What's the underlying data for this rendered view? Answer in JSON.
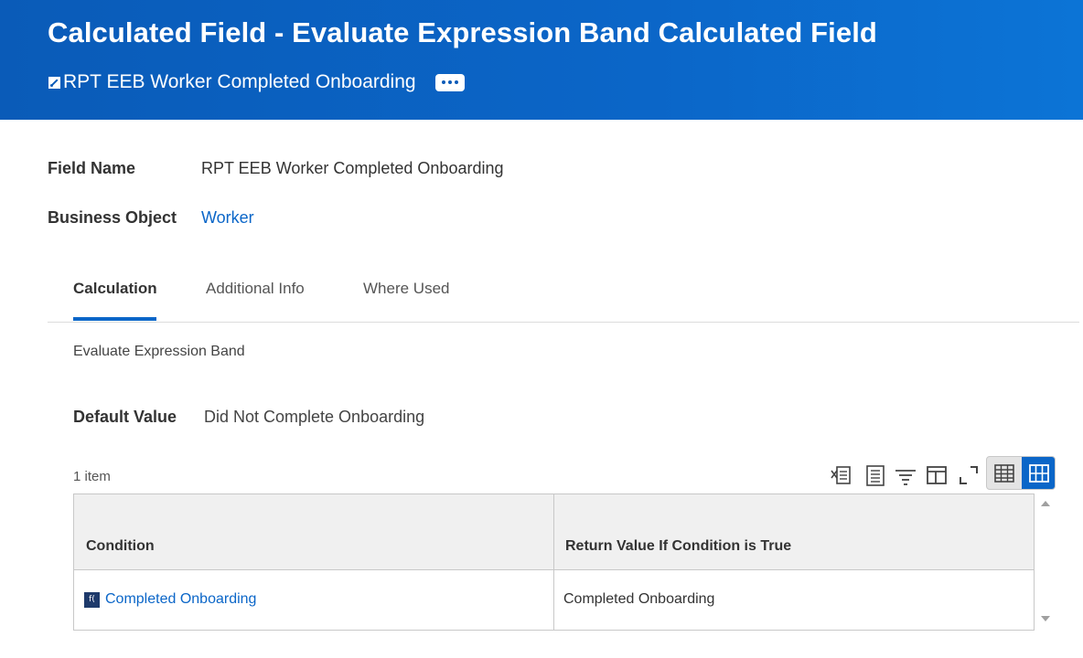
{
  "header": {
    "title": "Calculated Field - Evaluate Expression Band Calculated Field",
    "subtitle": "RPT EEB Worker Completed Onboarding",
    "subtitle_icon": "related-object-icon",
    "more_icon": "more-options-icon",
    "background": "#0b66c8"
  },
  "fields": {
    "field_name_label": "Field Name",
    "field_name_value": "RPT EEB Worker Completed Onboarding",
    "business_object_label": "Business Object",
    "business_object_value": "Worker"
  },
  "tabs": [
    {
      "label": "Calculation",
      "active": true
    },
    {
      "label": "Additional Info",
      "active": false
    },
    {
      "label": "Where Used",
      "active": false
    }
  ],
  "calculation": {
    "type_text": "Evaluate Expression Band",
    "default_value_label": "Default Value",
    "default_value": "Did Not Complete Onboarding",
    "item_count": "1 item"
  },
  "toolbar": {
    "icons": [
      "export-to-excel-icon",
      "export-to-pdf-icon",
      "filter-icon",
      "column-settings-icon",
      "fullscreen-icon",
      "table-view-icon",
      "grid-view-icon"
    ]
  },
  "grid": {
    "columns": [
      "Condition",
      "Return Value If Condition is True"
    ],
    "rows": [
      {
        "condition": "Completed Onboarding",
        "return_value": "Completed Onboarding",
        "condition_icon": "calculated-field-icon"
      }
    ]
  },
  "colors": {
    "accent": "#0b66c8",
    "link": "#0b66c8",
    "text": "#333333"
  }
}
